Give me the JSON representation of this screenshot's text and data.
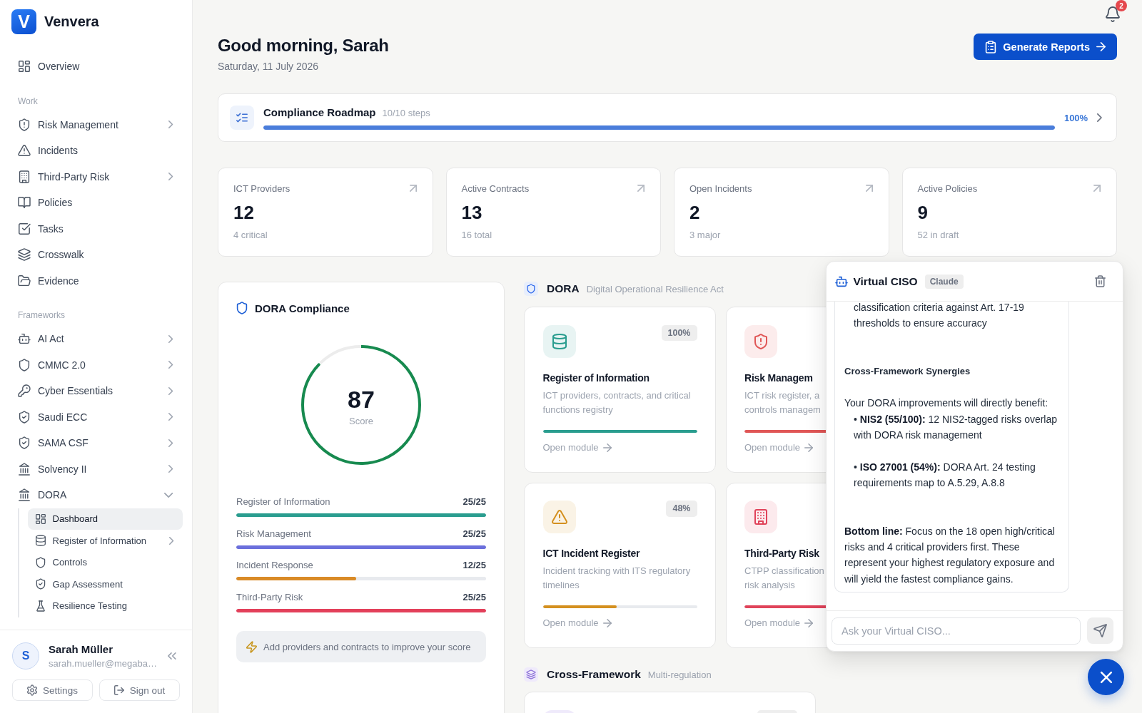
{
  "brand": {
    "logo": "V",
    "name": "Venvera"
  },
  "sidebar": {
    "sections": [
      {
        "items": [
          {
            "label": "Overview",
            "selected": false
          }
        ]
      },
      {
        "title": "Work",
        "items": [
          {
            "label": "Risk Management",
            "selected": false,
            "expanded": false
          },
          {
            "label": "Incidents",
            "selected": false
          },
          {
            "label": "Third-Party Risk",
            "selected": false,
            "expanded": false
          },
          {
            "label": "Policies",
            "selected": false
          },
          {
            "label": "Tasks",
            "selected": false
          },
          {
            "label": "Crosswalk",
            "selected": false
          },
          {
            "label": "Evidence",
            "selected": false
          }
        ]
      },
      {
        "title": "Frameworks",
        "items": [
          {
            "label": "AI Act",
            "selected": false,
            "expanded": false
          },
          {
            "label": "CMMC 2.0",
            "selected": false,
            "expanded": false
          },
          {
            "label": "Cyber Essentials",
            "selected": false,
            "expanded": false
          },
          {
            "label": "Saudi ECC",
            "selected": false,
            "expanded": false
          },
          {
            "label": "SAMA CSF",
            "selected": false,
            "expanded": false
          },
          {
            "label": "Solvency II",
            "selected": false,
            "expanded": false
          },
          {
            "label": "DORA",
            "selected": false,
            "expanded": true,
            "children": [
              {
                "label": "Dashboard",
                "selected": true
              },
              {
                "label": "Register of Information",
                "selected": false,
                "expanded": false
              },
              {
                "label": "Controls",
                "selected": false
              },
              {
                "label": "Gap Assessment",
                "selected": false
              },
              {
                "label": "Resilience Testing",
                "selected": false
              }
            ]
          }
        ]
      }
    ],
    "user": {
      "initial": "S",
      "name": "Sarah Müller",
      "email": "sarah.mueller@megaba…"
    },
    "buttons": [
      "Settings",
      "Sign out"
    ]
  },
  "header": {
    "greeting": "Good morning, Sarah",
    "date": "Saturday, 11 July 2026",
    "notification_count": "2",
    "action": "Generate Reports"
  },
  "roadmap": {
    "title": "Compliance Roadmap",
    "steps": "10/10 steps",
    "level": 1,
    "percent": "100%"
  },
  "stats": [
    {
      "label": "ICT Providers",
      "value": "12",
      "note": "4 critical"
    },
    {
      "label": "Active Contracts",
      "value": "13",
      "note": "16 total"
    },
    {
      "label": "Open Incidents",
      "value": "2",
      "note": "3 major"
    },
    {
      "label": "Active Policies",
      "value": "9",
      "note": "52 in draft"
    }
  ],
  "compliance": {
    "title": "DORA Compliance",
    "score": "87",
    "score_label": "Score",
    "areas": [
      {
        "name": "Register of Information",
        "value": "25/25",
        "level": 1,
        "color": "#2a9d8f"
      },
      {
        "name": "Risk Management",
        "value": "25/25",
        "level": 1,
        "color": "#6b6fdc"
      },
      {
        "name": "Incident Response",
        "value": "12/25",
        "level": 0.48,
        "color": "#d98a26"
      },
      {
        "name": "Third-Party Risk",
        "value": "25/25",
        "level": 1,
        "color": "#e3405a"
      }
    ],
    "tip": "Add providers and contracts to improve your score"
  },
  "dora": {
    "title": "DORA",
    "subtitle": "Digital Operational Resilience Act",
    "rows": [
      [
        {
          "title": "Register of Information",
          "description": "ICT providers, contracts, and critical functions registry",
          "badge": "100%",
          "level": 1,
          "color": "#2a9d8f",
          "link": "Open module"
        },
        {
          "title": "Risk Managem",
          "description": "ICT risk register, a\ncontrols managem",
          "level": 1,
          "color": "#e05656",
          "link": "Open module"
        }
      ],
      [
        {
          "title": "ICT Incident Register",
          "description": "Incident tracking with ITS regulatory timelines",
          "badge": "48%",
          "level": 0.48,
          "color": "#d4901f",
          "link": "Open module"
        },
        {
          "title": "Third-Party Risk",
          "description": "CTPP classification\nrisk analysis",
          "level": 1,
          "color": "#e0435a",
          "link": "Open module"
        }
      ]
    ]
  },
  "cross_framework": {
    "title": "Cross-Framework",
    "subtitle": "Multi-regulation",
    "modules": [
      {
        "kind": "module"
      }
    ]
  },
  "assistant": {
    "title": "Virtual CISO",
    "model": "Claude",
    "blocks": [
      {
        "kind": "bullet",
        "text": "classification criteria against Art. 17-19 thresholds to ensure accuracy"
      },
      {
        "kind": "heading",
        "text": "Cross-Framework Synergies"
      },
      {
        "kind": "paragraph",
        "text": "Your DORA improvements will directly benefit:"
      },
      {
        "kind": "bullet",
        "text": "• **NIS2 (55/100):** 12 NIS2-tagged risks overlap with DORA risk management"
      },
      {
        "kind": "bullet",
        "text": "• **ISO 27001 (54%):** DORA Art. 24 testing requirements map to A.5.29, A.8.8"
      },
      {
        "kind": "paragraph",
        "text": "**Bottom line:** Focus on the 18 open high/critical risks and 4 critical providers first. These represent your highest regulatory exposure and will yield the fastest compliance gains."
      }
    ],
    "placeholder": "Ask your Virtual CISO..."
  }
}
